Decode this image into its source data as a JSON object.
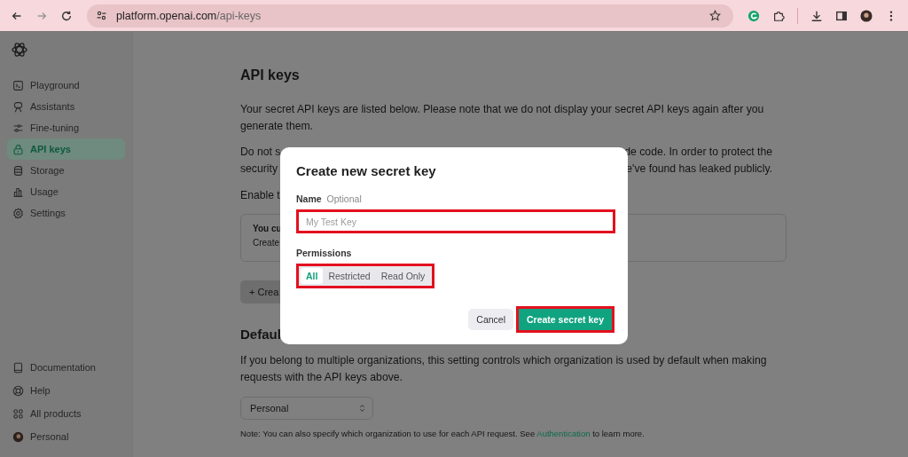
{
  "browser": {
    "url_host": "platform.openai.com",
    "url_path": "/api-keys"
  },
  "sidebar": {
    "items": [
      {
        "label": "Playground",
        "selected": false
      },
      {
        "label": "Assistants",
        "selected": false
      },
      {
        "label": "Fine-tuning",
        "selected": false
      },
      {
        "label": "API keys",
        "selected": true
      },
      {
        "label": "Storage",
        "selected": false
      },
      {
        "label": "Usage",
        "selected": false
      },
      {
        "label": "Settings",
        "selected": false
      }
    ],
    "footer_items": [
      {
        "label": "Documentation"
      },
      {
        "label": "Help"
      },
      {
        "label": "All products"
      },
      {
        "label": "Personal"
      }
    ]
  },
  "main": {
    "title": "API keys",
    "intro": "Your secret API keys are listed below. Please note that we do not display your secret API keys again after you generate them.",
    "warning_lines": [
      {
        "left": "Do not s",
        "right": "de code. In order to protect the"
      },
      {
        "left": "security",
        "right": "e've found has leaked publicly."
      }
    ],
    "enable": "Enable t",
    "card": {
      "title": "You cu",
      "text": "Create"
    },
    "create_button": "+ Crea",
    "default_heading": "Defaul",
    "default_text": "If you belong to multiple organizations, this setting controls which organization is used by default when making requests with the API keys above.",
    "org_select": "Personal",
    "note_before": "Note: You can also specify which organization to use for each API request. See",
    "note_link": "Authentication",
    "note_after": "to learn more."
  },
  "dialog": {
    "title": "Create new secret key",
    "name_label": "Name",
    "name_hint": "Optional",
    "name_placeholder": "My Test Key",
    "permissions_label": "Permissions",
    "permissions": [
      {
        "label": "All",
        "selected": true
      },
      {
        "label": "Restricted",
        "selected": false
      },
      {
        "label": "Read Only",
        "selected": false
      }
    ],
    "buttons": [
      {
        "label": "Cancel",
        "kind": "secondary"
      },
      {
        "label": "Create secret key",
        "kind": "primary"
      }
    ]
  }
}
